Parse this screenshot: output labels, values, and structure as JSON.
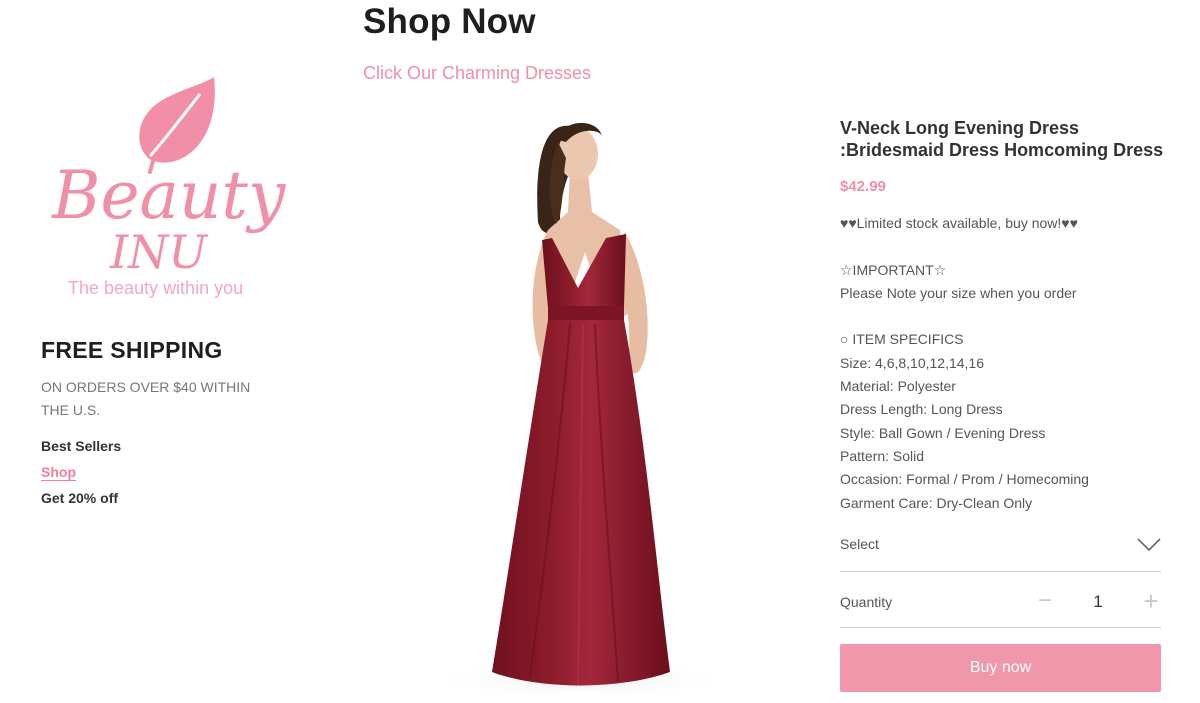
{
  "header": {
    "title": "Shop Now",
    "subtitle": "Click Our Charming Dresses"
  },
  "logo": {
    "brand": "Beauty",
    "brand2": "INU",
    "tagline": "The beauty within you",
    "color": "#f28fa8"
  },
  "sidebar": {
    "shipping_title": "FREE SHIPPING",
    "shipping_note": "ON ORDERS OVER $40 WITHIN THE U.S.",
    "links": [
      "Best Sellers",
      "Shop",
      "Get 20% off"
    ]
  },
  "product": {
    "title": "V-Neck Long Evening Dress :Bridesmaid Dress Homcoming Dress",
    "price": "$42.99",
    "stock_note": "♥♥Limited stock available, buy now!♥♥",
    "important_heading": "☆IMPORTANT☆",
    "important_text": "Please Note your size when you order",
    "specs_heading": "○ ITEM SPECIFICS",
    "specs": [
      "Size: 4,6,8,10,12,14,16",
      "Material: Polyester",
      "Dress Length: Long Dress",
      "Style: Ball Gown / Evening Dress",
      "Pattern: Solid",
      "Occasion: Formal / Prom / Homecoming",
      "Garment Care: Dry-Clean Only"
    ],
    "dress_color": "#8e1c2b"
  },
  "select": {
    "label": "Select"
  },
  "quantity": {
    "label": "Quantity",
    "value": "1",
    "minus": "−",
    "plus": "+"
  },
  "buy_button": {
    "label": "Buy now",
    "color": "#f097ab"
  },
  "accent_color": "#ef8fa8"
}
